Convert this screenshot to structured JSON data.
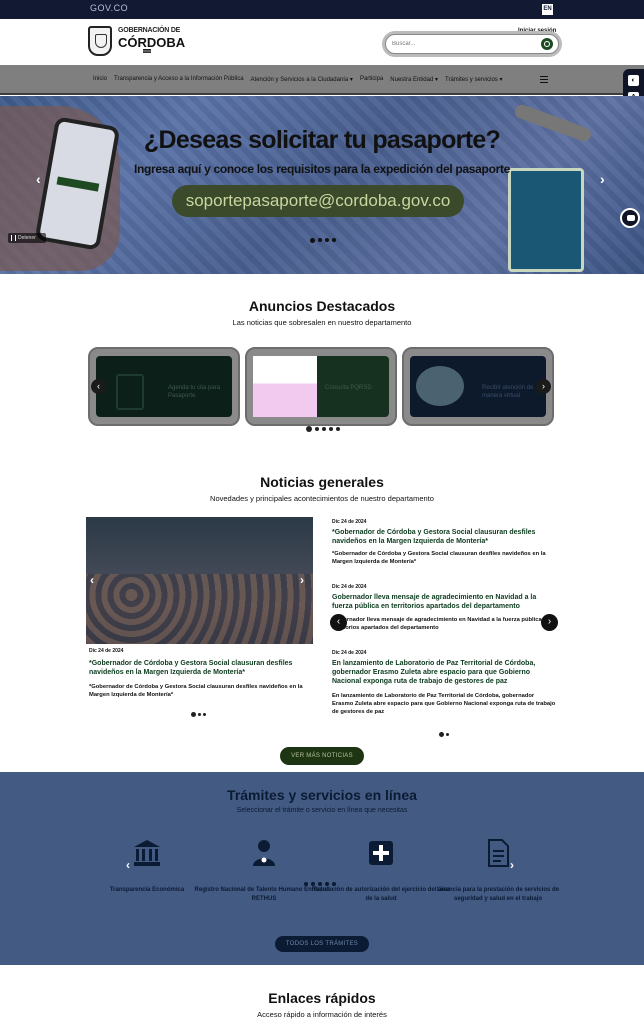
{
  "topbar": {
    "gov_label": "GOV.CO",
    "lang": "EN"
  },
  "header": {
    "logo_line1": "GOBERNACIÓN DE",
    "logo_line2": "CÓRDOBA",
    "login": "Iniciar sesión",
    "search_placeholder": "Buscar..."
  },
  "nav": {
    "items": [
      "Inicio",
      "Transparencia y Acceso a la Información Pública",
      "Atención y Servicios a la Ciudadanía ▾",
      "Participa",
      "Nuestra Entidad ▾",
      "Trámites y servicios ▾"
    ]
  },
  "hero": {
    "title": "¿Deseas solicitar tu pasaporte?",
    "subtitle": "Ingresa aquí y conoce los requisitos para la expedición del pasaporte",
    "email": "soportepasaporte@cordoba.gov.co",
    "pause_label": "Detener"
  },
  "announcements": {
    "title": "Anuncios Destacados",
    "subtitle": "Las noticias que sobresalen en nuestro departamento",
    "cards": [
      {
        "text": "Agenda tu cita para Pasaporte"
      },
      {
        "text": "Consulta PQRSD"
      },
      {
        "text": "Recibir atención de manera virtual"
      }
    ]
  },
  "news": {
    "title": "Noticias generales",
    "subtitle": "Novedades y principales acontecimientos de nuestro departamento",
    "featured": {
      "date": "Dic 24 de 2024",
      "title": "*Gobernador de Córdoba y Gestora Social clausuran desfiles navideños en la Margen Izquierda de Montería*",
      "desc": "*Gobernador de Córdoba y Gestora Social clausuran desfiles navideños en la Margen Izquierda de Montería*"
    },
    "list": [
      {
        "date": "Dic 24 de 2024",
        "title": "*Gobernador de Córdoba y Gestora Social clausuran desfiles navideños en la Margen Izquierda de Montería*",
        "desc": "*Gobernador de Córdoba y Gestora Social clausuran desfiles navideños en la Margen Izquierda de Montería*"
      },
      {
        "date": "Dic 24 de 2024",
        "title": "Gobernador lleva mensaje de agradecimiento en Navidad a la fuerza pública en territorios apartados del departamento",
        "desc": "Gobernador lleva mensaje de agradecimiento en Navidad a la fuerza pública en territorios apartados del departamento"
      },
      {
        "date": "Dic 24 de 2024",
        "title": "En lanzamiento de Laboratorio de Paz Territorial de Córdoba, gobernador Erasmo Zuleta abre espacio para que Gobierno Nacional exponga ruta de trabajo de gestores de paz",
        "desc": "En lanzamiento de Laboratorio de Paz Territorial de Córdoba, gobernador Erasmo Zuleta abre espacio para que Gobierno Nacional exponga ruta de trabajo de gestores de paz"
      }
    ],
    "more_label": "VER MÁS NOTICIAS"
  },
  "tramites": {
    "title": "Trámites y servicios en línea",
    "subtitle": "Seleccionar el trámite o servicio en línea que necesitas",
    "items": [
      {
        "icon": "bank-icon",
        "label": "Transparencia Económica"
      },
      {
        "icon": "health-worker-icon",
        "label": "Registro Nacional de Talento Humano En Salud -RETHUS"
      },
      {
        "icon": "medical-cross-icon",
        "label": "Resolución de autorización del ejercicio del área de la salud"
      },
      {
        "icon": "document-icon",
        "label": "Licencia para la prestación de servicios de seguridad y salud en el trabajo"
      }
    ],
    "all_label": "TODOS LOS TRÁMITES"
  },
  "quicklinks": {
    "title": "Enlaces rápidos",
    "subtitle": "Acceso rápido a información de interés"
  }
}
